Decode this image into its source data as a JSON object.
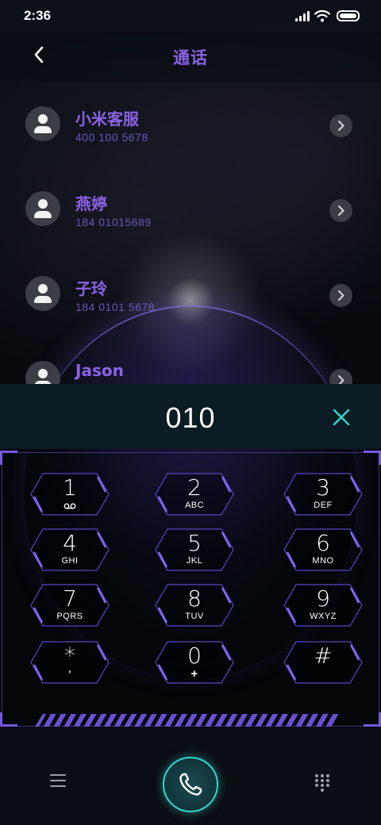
{
  "status_bar": {
    "time": "2:36"
  },
  "header": {
    "title": "通话"
  },
  "contacts": [
    {
      "name": "小米客服",
      "number": "400 100 5678"
    },
    {
      "name": "燕婷",
      "number": "184 01015689"
    },
    {
      "name": "子玲",
      "number": "184 0101 5678"
    },
    {
      "name": "Jason",
      "number": ""
    }
  ],
  "dialer": {
    "input": "010",
    "keys": [
      {
        "digit": "1",
        "letters": ""
      },
      {
        "digit": "2",
        "letters": "ABC"
      },
      {
        "digit": "3",
        "letters": "DEF"
      },
      {
        "digit": "4",
        "letters": "GHI"
      },
      {
        "digit": "5",
        "letters": "JKL"
      },
      {
        "digit": "6",
        "letters": "MNO"
      },
      {
        "digit": "7",
        "letters": "PQRS"
      },
      {
        "digit": "8",
        "letters": "TUV"
      },
      {
        "digit": "9",
        "letters": "WXYZ"
      },
      {
        "digit": "*",
        "letters": ","
      },
      {
        "digit": "0",
        "letters": "+"
      },
      {
        "digit": "#",
        "letters": ""
      }
    ]
  },
  "colors": {
    "accent_purple": "#8b63e6",
    "accent_teal": "#35d6cc",
    "frame_purple": "#7559e0"
  },
  "icons": {
    "back": "chevron-left-icon",
    "clear": "close-icon",
    "voicemail": "voicemail-icon",
    "menu": "menu-icon",
    "call": "phone-icon",
    "keypad": "keypad-grid-icon"
  }
}
